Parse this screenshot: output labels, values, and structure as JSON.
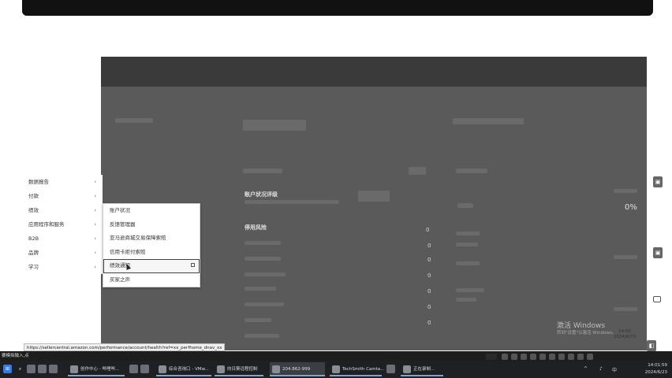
{
  "menu": {
    "items": [
      {
        "label": "数据报告",
        "arrow": "›"
      },
      {
        "label": "付款",
        "arrow": "›"
      },
      {
        "label": "绩效",
        "arrow": "›"
      },
      {
        "label": "应用程序和服务",
        "arrow": "›"
      },
      {
        "label": "B2B",
        "arrow": "›"
      },
      {
        "label": "品牌",
        "arrow": "›"
      },
      {
        "label": "学习",
        "arrow": "›"
      }
    ]
  },
  "submenu": {
    "items": [
      {
        "label": "账户状况"
      },
      {
        "label": "反馈管理器"
      },
      {
        "label": "亚马逊商城交易保障索赔"
      },
      {
        "label": "信用卡拒付索赔"
      },
      {
        "label": "绩效通知"
      },
      {
        "label": "买家之声"
      }
    ]
  },
  "content": {
    "section_left": "账户状况评级",
    "section_mid": "停用风险",
    "percent": "0%",
    "nums": [
      "0",
      "0",
      "0",
      "0",
      "0",
      "0",
      "0"
    ]
  },
  "status_url": "https://sellercentral.amazon.com/performance/account/health?ref=xx_perfhome_dnav_xx",
  "watermark": {
    "title": "激活 Windows",
    "sub": "转到\"设置\"以激活 Windows。"
  },
  "mini_bar_label": "要模拟输入,点",
  "taskbar": {
    "apps": [
      {
        "label": "创作中心 - 哔哩哔..."
      },
      {
        "label": "综合咨询口 - VMw..."
      },
      {
        "label": "向日葵远程控制"
      },
      {
        "label": "204.862-999"
      },
      {
        "label": "TechSmith Camta..."
      },
      {
        "label": "正在录制..."
      }
    ],
    "clock_time": "14:01:59",
    "clock_date": "2024/6/23",
    "clock2_time": "14:02",
    "clock2_date": "2024/6/23",
    "lang": "中"
  },
  "colors": {
    "overlay": "#5a5a5a",
    "taskbar": "#1f2024",
    "accent": "#7aa6d6"
  }
}
